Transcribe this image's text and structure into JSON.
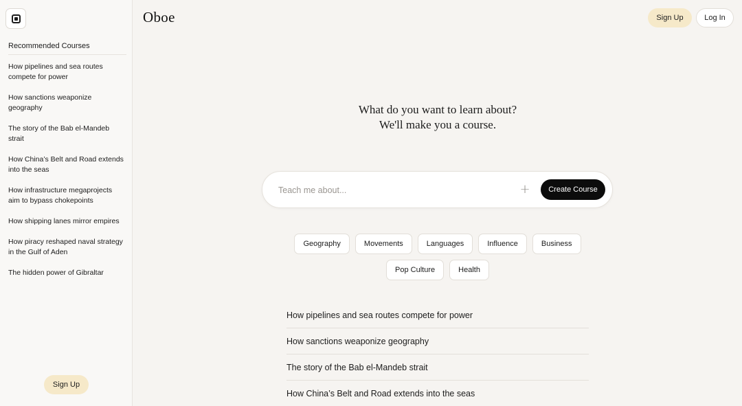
{
  "app": {
    "logo": "Oboe"
  },
  "header": {
    "signup_label": "Sign Up",
    "login_label": "Log In"
  },
  "sidebar": {
    "toggle_icon": "sidebar-toggle-icon",
    "heading": "Recommended Courses",
    "items": [
      "How pipelines and sea routes compete for power",
      "How sanctions weaponize geography",
      "The story of the Bab el-Mandeb strait",
      "How China’s Belt and Road extends into the seas",
      "How infrastructure megaprojects aim to bypass chokepoints",
      "How shipping lanes mirror empires",
      "How piracy reshaped naval strategy in the Gulf of Aden",
      "The hidden power of Gibraltar"
    ],
    "signup_label": "Sign Up"
  },
  "hero": {
    "line1": "What do you want to learn about?",
    "line2": "We'll make you a course."
  },
  "search": {
    "placeholder": "Teach me about...",
    "value": "",
    "add_icon": "plus-icon",
    "create_label": "Create Course"
  },
  "categories": [
    "Geography",
    "Movements",
    "Languages",
    "Influence",
    "Business",
    "Pop Culture",
    "Health"
  ],
  "courses": [
    "How pipelines and sea routes compete for power",
    "How sanctions weaponize geography",
    "The story of the Bab el-Mandeb strait",
    "How China’s Belt and Road extends into the seas"
  ],
  "colors": {
    "background": "#f6f4f1",
    "sidebar": "#f9f8f6",
    "signup_accent": "#f6e9c9",
    "primary_button": "#0c0c0c"
  }
}
